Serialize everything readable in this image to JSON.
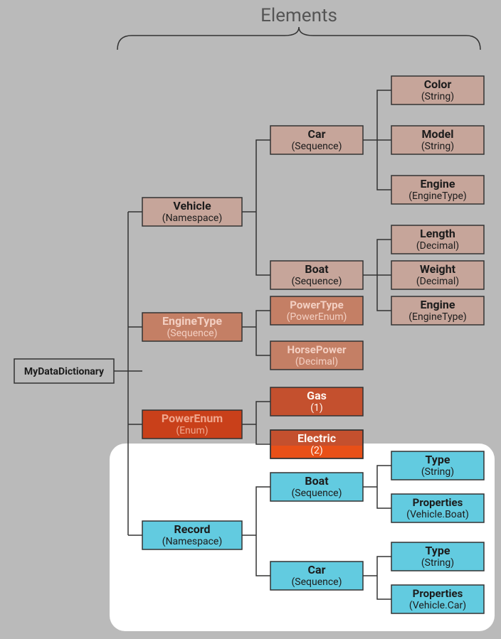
{
  "title": "Elements",
  "root": {
    "name": "MyDataDictionary",
    "sub": ""
  },
  "vehicle": {
    "name": "Vehicle",
    "sub": "(Namespace)"
  },
  "car": {
    "name": "Car",
    "sub": "(Sequence)"
  },
  "boat": {
    "name": "Boat",
    "sub": "(Sequence)"
  },
  "car_color": {
    "name": "Color",
    "sub": "(String)"
  },
  "car_model": {
    "name": "Model",
    "sub": "(String)"
  },
  "car_engine": {
    "name": "Engine",
    "sub": "(EngineType)"
  },
  "boat_length": {
    "name": "Length",
    "sub": "(Decimal)"
  },
  "boat_weight": {
    "name": "Weight",
    "sub": "(Decimal)"
  },
  "boat_engine": {
    "name": "Engine",
    "sub": "(EngineType)"
  },
  "enginetype": {
    "name": "EngineType",
    "sub": "(Sequence)"
  },
  "et_powertype": {
    "name": "PowerType",
    "sub": "(PowerEnum)"
  },
  "et_horsepower": {
    "name": "HorsePower",
    "sub": "(Decimal)"
  },
  "powerenum": {
    "name": "PowerEnum",
    "sub": "(Enum)"
  },
  "pe_gas": {
    "name": "Gas",
    "sub": "(1)"
  },
  "pe_electric": {
    "name": "Electric",
    "sub": "(2)"
  },
  "record": {
    "name": "Record",
    "sub": "(Namespace)"
  },
  "r_boat": {
    "name": "Boat",
    "sub": "(Sequence)"
  },
  "r_car": {
    "name": "Car",
    "sub": "(Sequence)"
  },
  "r_boat_type": {
    "name": "Type",
    "sub": "(String)"
  },
  "r_boat_props": {
    "name": "Properties",
    "sub": "(Vehicle.Boat)"
  },
  "r_car_type": {
    "name": "Type",
    "sub": "(String)"
  },
  "r_car_props": {
    "name": "Properties",
    "sub": "(Vehicle.Car)"
  },
  "chart_data": {
    "type": "tree",
    "title": "Elements",
    "root": {
      "name": "MyDataDictionary",
      "children": [
        {
          "name": "Vehicle",
          "kind": "Namespace",
          "children": [
            {
              "name": "Car",
              "kind": "Sequence",
              "children": [
                {
                  "name": "Color",
                  "kind": "String"
                },
                {
                  "name": "Model",
                  "kind": "String"
                },
                {
                  "name": "Engine",
                  "kind": "EngineType"
                }
              ]
            },
            {
              "name": "Boat",
              "kind": "Sequence",
              "children": [
                {
                  "name": "Length",
                  "kind": "Decimal"
                },
                {
                  "name": "Weight",
                  "kind": "Decimal"
                },
                {
                  "name": "Engine",
                  "kind": "EngineType"
                }
              ]
            }
          ]
        },
        {
          "name": "EngineType",
          "kind": "Sequence",
          "children": [
            {
              "name": "PowerType",
              "kind": "PowerEnum"
            },
            {
              "name": "HorsePower",
              "kind": "Decimal"
            }
          ]
        },
        {
          "name": "PowerEnum",
          "kind": "Enum",
          "children": [
            {
              "name": "Gas",
              "value": 1
            },
            {
              "name": "Electric",
              "value": 2
            }
          ]
        },
        {
          "name": "Record",
          "kind": "Namespace",
          "highlight": true,
          "children": [
            {
              "name": "Boat",
              "kind": "Sequence",
              "children": [
                {
                  "name": "Type",
                  "kind": "String"
                },
                {
                  "name": "Properties",
                  "kind": "Vehicle.Boat"
                }
              ]
            },
            {
              "name": "Car",
              "kind": "Sequence",
              "children": [
                {
                  "name": "Type",
                  "kind": "String"
                },
                {
                  "name": "Properties",
                  "kind": "Vehicle.Car"
                }
              ]
            }
          ]
        }
      ]
    }
  }
}
